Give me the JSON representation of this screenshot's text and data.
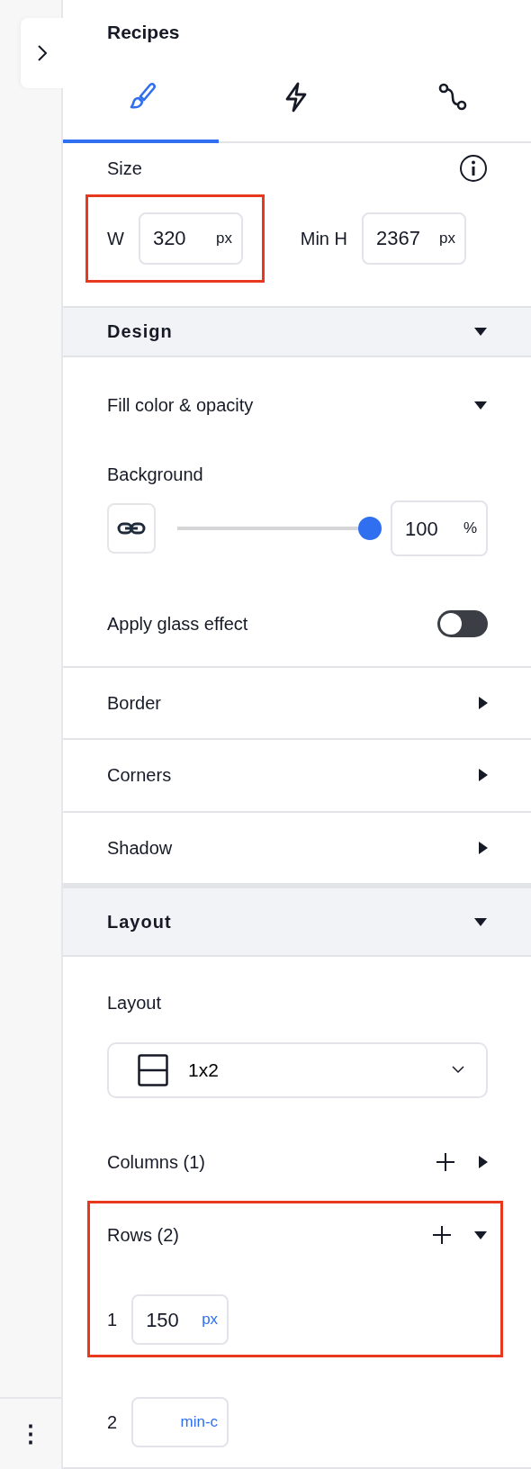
{
  "side_menu": {
    "label": "⋮"
  },
  "panel": {
    "title": "Recipes",
    "tabs": [
      {
        "kind": "brush",
        "selected": true
      },
      {
        "kind": "bolt",
        "selected": false
      },
      {
        "kind": "path",
        "selected": false
      }
    ]
  },
  "size": {
    "label": "Size",
    "fields": [
      {
        "label": "W",
        "value": "320",
        "unit": "px",
        "highlighted": true
      },
      {
        "label": "Min H",
        "value": "2367",
        "unit": "px",
        "highlighted": false
      }
    ]
  },
  "design": {
    "title": "Design",
    "expanded": true,
    "fill": {
      "title": "Fill color & opacity",
      "expanded": true,
      "background_label": "Background",
      "level": 1.0,
      "opacity": "100",
      "unit": "%",
      "glass": {
        "label": "Apply glass effect",
        "on": false
      }
    },
    "subsections": [
      {
        "title": "Border",
        "expanded": false
      },
      {
        "title": "Corners",
        "expanded": false
      },
      {
        "title": "Shadow",
        "expanded": false
      }
    ]
  },
  "layout": {
    "title": "Layout",
    "expanded": true,
    "layout_label": "Layout",
    "dropdown": {
      "value": "1x2"
    },
    "columns": {
      "title": "Columns (1)",
      "expanded": false
    },
    "rows": {
      "title": "Rows (2)",
      "expanded": true,
      "highlighted": true,
      "items": [
        {
          "index": "1",
          "value": "150",
          "unit": "px",
          "highlighted": true
        },
        {
          "index": "2",
          "unit": "min-c",
          "highlighted": false
        }
      ]
    }
  }
}
